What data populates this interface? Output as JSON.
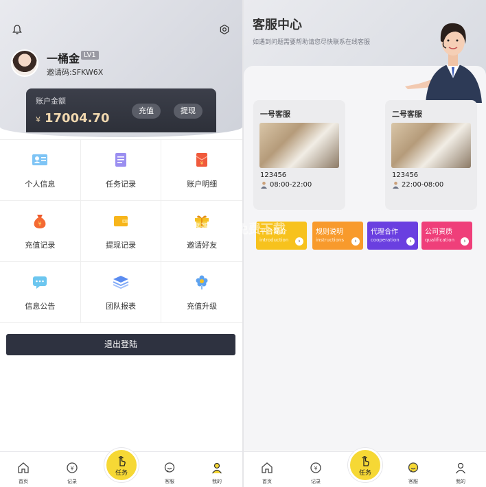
{
  "left": {
    "user": {
      "name": "一桶金",
      "level": "LV1",
      "invite_code": "邀请码:SFKW6X"
    },
    "balance": {
      "label": "账户金额",
      "currency": "¥",
      "amount": "17004.70",
      "recharge_label": "充值",
      "withdraw_label": "提现"
    },
    "menu": [
      {
        "label": "个人信息",
        "icon": "id-card-icon"
      },
      {
        "label": "任务记录",
        "icon": "document-icon"
      },
      {
        "label": "账户明细",
        "icon": "red-envelope-icon"
      },
      {
        "label": "充值记录",
        "icon": "money-bag-icon"
      },
      {
        "label": "提现记录",
        "icon": "wallet-icon"
      },
      {
        "label": "邀请好友",
        "icon": "gift-icon"
      },
      {
        "label": "信息公告",
        "icon": "message-icon"
      },
      {
        "label": "团队报表",
        "icon": "layers-icon"
      },
      {
        "label": "充值升级",
        "icon": "flower-icon"
      }
    ],
    "logout_label": "退出登陆"
  },
  "right": {
    "title": "客服中心",
    "subtitle": "如遇到问题需要帮助请您尽快联系在线客服",
    "services": [
      {
        "name": "一号客服",
        "number": "123456",
        "hours": "08:00-22:00"
      },
      {
        "name": "二号客服",
        "number": "123456",
        "hours": "22:00-08:00"
      }
    ],
    "promos": [
      {
        "title": "平台简介",
        "sub": "introduction",
        "color": "#f7c21d"
      },
      {
        "title": "规则说明",
        "sub": "instructions",
        "color": "#f89a2c"
      },
      {
        "title": "代理合作",
        "sub": "cooperation",
        "color": "#6a3fe0"
      },
      {
        "title": "公司资质",
        "sub": "qualification",
        "color": "#ef3f7a"
      }
    ]
  },
  "tabbar": {
    "home": "首页",
    "records": "记录",
    "task": "任务",
    "service": "客服",
    "mine": "我的"
  },
  "colors": {
    "dark": "#2e3240",
    "gold_amount": "#f2d9b0",
    "task_yellow": "#f6d835"
  },
  "watermark": "整理资源VIP免费下载"
}
